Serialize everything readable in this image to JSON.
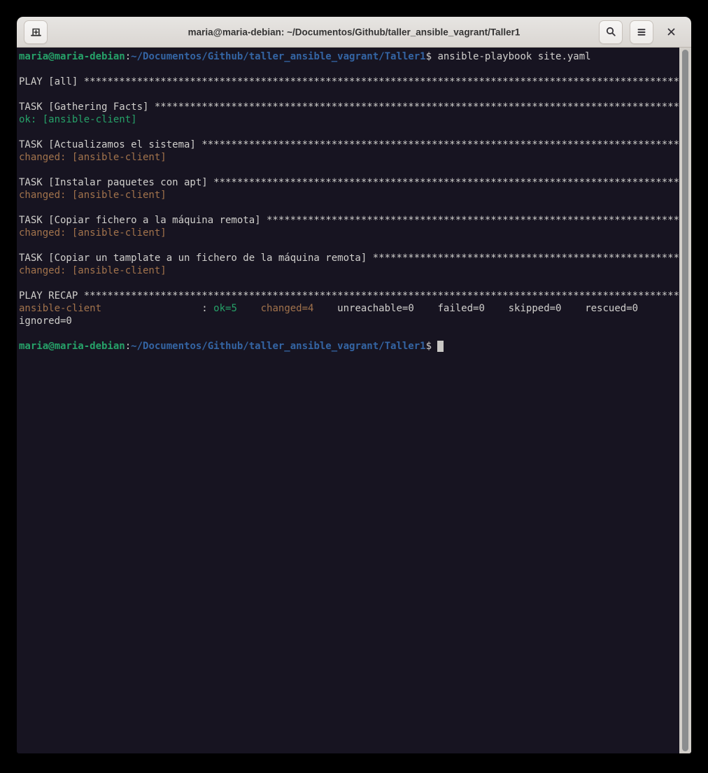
{
  "window": {
    "title": "maria@maria-debian: ~/Documentos/Github/taller_ansible_vagrant/Taller1"
  },
  "titlebar": {
    "icons": {
      "new_tab": "tab-new-icon",
      "search": "search-icon",
      "menu": "hamburger-menu-icon",
      "close": "close-icon"
    }
  },
  "colors": {
    "outer_bg": "#000000",
    "titlebar_bg": "#dad6d2",
    "terminal_bg": "#171421",
    "terminal_fg": "#d0cfcc",
    "prompt_user_green": "#26a269",
    "prompt_path_blue": "#3465a4",
    "ok_green": "#26a269",
    "changed_yellow": "#a2734c",
    "cursor": "#c9c7c4",
    "scrollbar_track": "#d3cfca",
    "scrollbar_thumb": "#8b8d8f"
  },
  "terminal": {
    "lines": [
      {
        "segs": [
          [
            "u",
            "maria@maria-debian"
          ],
          [
            "f",
            ":"
          ],
          [
            "p",
            "~/Documentos/Github/taller_ansible_vagrant/Taller1"
          ],
          [
            "f",
            "$ ansible-playbook site.yaml"
          ]
        ]
      },
      {
        "segs": []
      },
      {
        "segs": [
          [
            "f",
            "PLAY [all] ************************************************************************************************************"
          ]
        ]
      },
      {
        "segs": []
      },
      {
        "segs": [
          [
            "f",
            "TASK [Gathering Facts] ************************************************************************************************"
          ]
        ]
      },
      {
        "segs": [
          [
            "g",
            "ok: [ansible-client]"
          ]
        ]
      },
      {
        "segs": []
      },
      {
        "segs": [
          [
            "f",
            "TASK [Actualizamos el sistema] ****************************************************************************************"
          ]
        ]
      },
      {
        "segs": [
          [
            "y",
            "changed: [ansible-client]"
          ]
        ]
      },
      {
        "segs": []
      },
      {
        "segs": [
          [
            "f",
            "TASK [Instalar paquetes con apt] **************************************************************************************"
          ]
        ]
      },
      {
        "segs": [
          [
            "y",
            "changed: [ansible-client]"
          ]
        ]
      },
      {
        "segs": []
      },
      {
        "segs": [
          [
            "f",
            "TASK [Copiar fichero a la máquina remota] *****************************************************************************"
          ]
        ]
      },
      {
        "segs": [
          [
            "y",
            "changed: [ansible-client]"
          ]
        ]
      },
      {
        "segs": []
      },
      {
        "segs": [
          [
            "f",
            "TASK [Copiar un tamplate a un fichero de la máquina remota] ***********************************************************"
          ]
        ]
      },
      {
        "segs": [
          [
            "y",
            "changed: [ansible-client]"
          ]
        ]
      },
      {
        "segs": []
      },
      {
        "segs": [
          [
            "f",
            "PLAY RECAP ************************************************************************************************************"
          ]
        ]
      },
      {
        "segs": [
          [
            "y",
            "ansible-client"
          ],
          [
            "f",
            "                 : "
          ],
          [
            "g",
            "ok=5"
          ],
          [
            "f",
            "    "
          ],
          [
            "y",
            "changed=4"
          ],
          [
            "f",
            "    unreachable=0    failed=0    skipped=0    rescued=0"
          ]
        ]
      },
      {
        "segs": [
          [
            "f",
            "ignored=0"
          ]
        ]
      },
      {
        "segs": []
      },
      {
        "segs": [
          [
            "u",
            "maria@maria-debian"
          ],
          [
            "f",
            ":"
          ],
          [
            "p",
            "~/Documentos/Github/taller_ansible_vagrant/Taller1"
          ],
          [
            "f",
            "$ "
          ],
          [
            "c",
            " "
          ]
        ]
      }
    ]
  }
}
